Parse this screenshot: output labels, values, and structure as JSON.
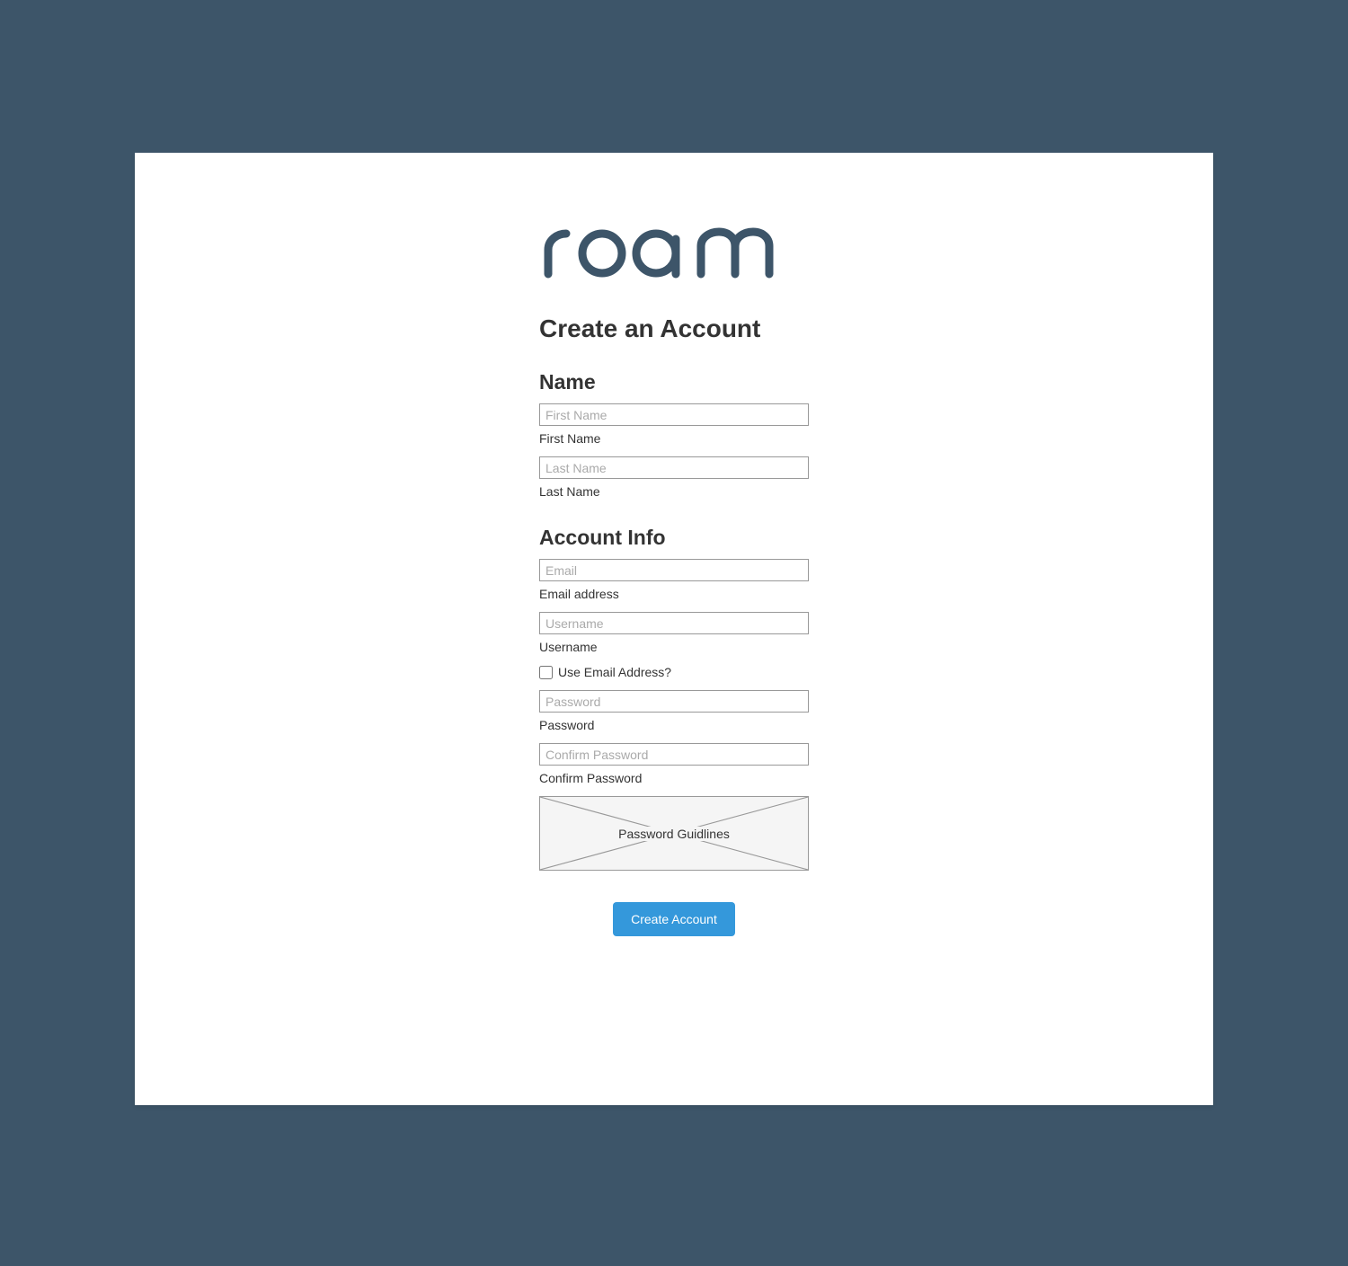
{
  "logo": {
    "text": "roam"
  },
  "header": {
    "title": "Create an Account"
  },
  "sections": {
    "name": {
      "title": "Name",
      "first_name": {
        "placeholder": "First Name",
        "label": "First Name",
        "value": ""
      },
      "last_name": {
        "placeholder": "Last Name",
        "label": "Last Name",
        "value": ""
      }
    },
    "account": {
      "title": "Account Info",
      "email": {
        "placeholder": "Email",
        "label": "Email address",
        "value": ""
      },
      "username": {
        "placeholder": "Username",
        "label": "Username",
        "value": ""
      },
      "use_email_checkbox": {
        "label": "Use Email Address?",
        "checked": false
      },
      "password": {
        "placeholder": "Password",
        "label": "Password",
        "value": ""
      },
      "confirm_password": {
        "placeholder": "Confirm Password",
        "label": "Confirm Password",
        "value": ""
      },
      "guidelines_placeholder": "Password Guidlines"
    }
  },
  "submit": {
    "label": "Create Account"
  }
}
